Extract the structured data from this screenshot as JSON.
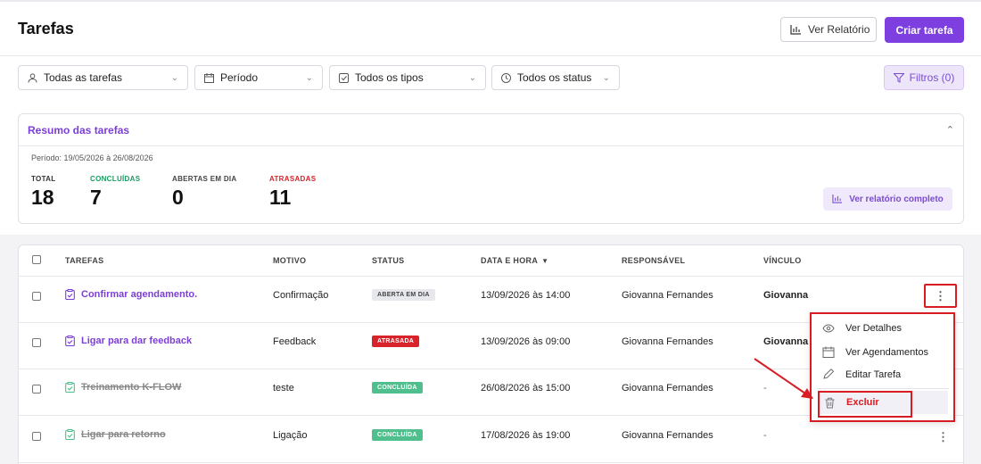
{
  "header": {
    "title": "Tarefas",
    "report_button": "Ver Relatório",
    "create_button": "Criar tarefa"
  },
  "filters": {
    "all_tasks": "Todas as tarefas",
    "period": "Período",
    "all_types": "Todos os tipos",
    "all_status": "Todos os status",
    "filters_button": "Filtros (0)"
  },
  "summary": {
    "title": "Resumo das tarefas",
    "period_text": "Período: 19/05/2026 à 26/08/2026",
    "stats": [
      {
        "label": "TOTAL",
        "value": "18",
        "color": "#333333"
      },
      {
        "label": "CONCLUÍDAS",
        "value": "7",
        "color": "#1f9a61"
      },
      {
        "label": "ABERTAS EM DIA",
        "value": "0",
        "color": "#444444"
      },
      {
        "label": "ATRASADAS",
        "value": "11",
        "color": "#d8232b"
      }
    ],
    "full_report_button": "Ver relatório completo"
  },
  "table": {
    "headers": {
      "tasks": "TAREFAS",
      "reason": "MOTIVO",
      "status": "STATUS",
      "datetime": "DATA E HORA",
      "owner": "RESPONSÁVEL",
      "link": "VÍNCULO"
    },
    "rows": [
      {
        "task": "Confirmar agendamento.",
        "reason": "Confirmação",
        "status": "ABERTA EM DIA",
        "datetime": "13/09/2026 às 14:00",
        "owner": "Giovanna Fernandes",
        "link": "Giovanna"
      },
      {
        "task": "Ligar para dar feedback",
        "reason": "Feedback",
        "status": "ATRASADA",
        "datetime": "13/09/2026 às 09:00",
        "owner": "Giovanna Fernandes",
        "link": "Giovanna"
      },
      {
        "task": "Treinamento K-FLOW",
        "reason": "teste",
        "status": "CONCLUÍDA",
        "datetime": "26/08/2026 às 15:00",
        "owner": "Giovanna Fernandes",
        "link": "-"
      },
      {
        "task": "Ligar para retorno",
        "reason": "Ligação",
        "status": "CONCLUÍDA",
        "datetime": "17/08/2026 às 19:00",
        "owner": "Giovanna Fernandes",
        "link": "-"
      }
    ]
  },
  "context_menu": {
    "details": "Ver Detalhes",
    "schedules": "Ver Agendamentos",
    "edit": "Editar Tarefa",
    "delete": "Excluir"
  },
  "colors": {
    "accent": "#7e3fe0",
    "highlight": "#d81c24"
  }
}
